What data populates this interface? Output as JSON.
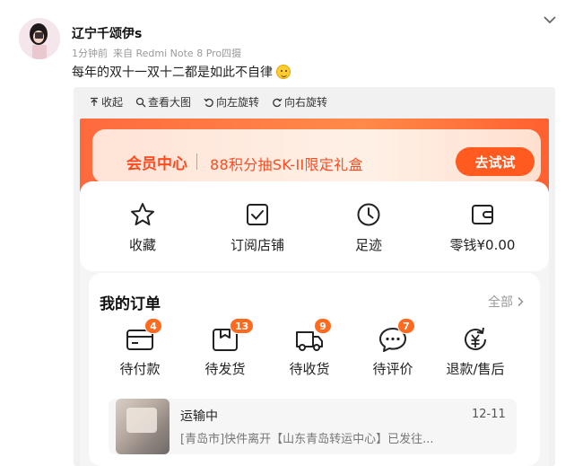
{
  "post": {
    "username": "辽宁千颂伊s",
    "time": "1分钟前",
    "source": "来自 Redmi Note 8 Pro四摄",
    "caption": "每年的双十一双十二都是如此不自律"
  },
  "toolbar": {
    "collapse": "收起",
    "view_large": "查看大图",
    "rotate_left": "向左旋转",
    "rotate_right": "向右旋转"
  },
  "banner": {
    "title": "会员中心",
    "promo": "88积分抽SK-II限定礼盒",
    "button": "去试试",
    "accent": "#ff5a1f"
  },
  "quick_links": [
    {
      "label": "收藏",
      "icon": "star-icon"
    },
    {
      "label": "订阅店铺",
      "icon": "subscribe-icon"
    },
    {
      "label": "足迹",
      "icon": "clock-icon"
    },
    {
      "label": "零钱¥0.00",
      "icon": "wallet-icon"
    }
  ],
  "orders": {
    "title": "我的订单",
    "all": "全部",
    "statuses": [
      {
        "label": "待付款",
        "badge": "4",
        "icon": "card-icon"
      },
      {
        "label": "待发货",
        "badge": "13",
        "icon": "package-icon"
      },
      {
        "label": "待收货",
        "badge": "9",
        "icon": "truck-icon"
      },
      {
        "label": "待评价",
        "badge": "7",
        "icon": "chat-icon"
      },
      {
        "label": "退款/售后",
        "badge": "",
        "icon": "refund-icon"
      }
    ],
    "shipment": {
      "status": "运输中",
      "date": "12-11",
      "detail": "[青岛市]快件离开【山东青岛转运中心】已发往..."
    }
  }
}
